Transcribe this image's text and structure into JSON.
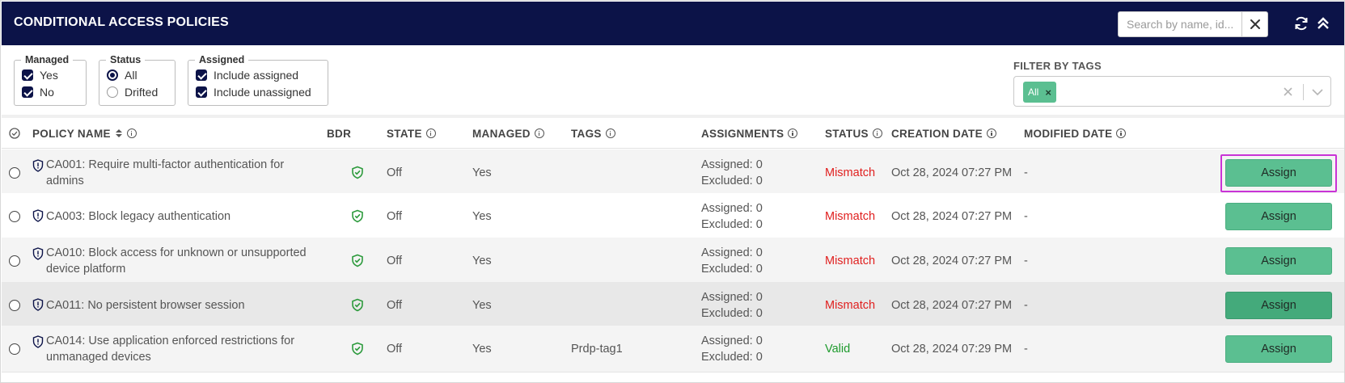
{
  "header": {
    "title": "CONDITIONAL ACCESS POLICIES",
    "search_placeholder": "Search by name, id...",
    "search_value": ""
  },
  "filters": {
    "managed": {
      "legend": "Managed",
      "options": [
        "Yes",
        "No"
      ],
      "checked": [
        true,
        true
      ]
    },
    "status": {
      "legend": "Status",
      "options": [
        "All",
        "Drifted"
      ],
      "selected": "All"
    },
    "assigned": {
      "legend": "Assigned",
      "options": [
        "Include assigned",
        "Include unassigned"
      ],
      "checked": [
        true,
        true
      ]
    },
    "tags": {
      "label": "FILTER BY TAGS",
      "chips": [
        "All"
      ]
    }
  },
  "columns": {
    "policy_name": "POLICY NAME",
    "bdr": "BDR",
    "state": "STATE",
    "managed": "MANAGED",
    "tags": "TAGS",
    "assignments": "ASSIGNMENTS",
    "status": "STATUS",
    "creation_date": "CREATION DATE",
    "modified_date": "MODIFIED DATE"
  },
  "rows": [
    {
      "name_line1": "CA001: Require multi-factor authentication for",
      "name_line2": "admins",
      "state": "Off",
      "managed": "Yes",
      "tags": "",
      "assigned": "Assigned: 0",
      "excluded": "Excluded: 0",
      "status": "Mismatch",
      "status_color": "#e0201f",
      "created": "Oct 28, 2024 07:27 PM",
      "modified": "-",
      "action": "Assign",
      "bg": "#f4f4f4",
      "highlighted": true
    },
    {
      "name_line1": "CA003: Block legacy authentication",
      "name_line2": "",
      "state": "Off",
      "managed": "Yes",
      "tags": "",
      "assigned": "Assigned: 0",
      "excluded": "Excluded: 0",
      "status": "Mismatch",
      "status_color": "#e0201f",
      "created": "Oct 28, 2024 07:27 PM",
      "modified": "-",
      "action": "Assign",
      "bg": "#ffffff",
      "highlighted": false
    },
    {
      "name_line1": "CA010: Block access for unknown or unsupported",
      "name_line2": "device platform",
      "state": "Off",
      "managed": "Yes",
      "tags": "",
      "assigned": "Assigned: 0",
      "excluded": "Excluded: 0",
      "status": "Mismatch",
      "status_color": "#e0201f",
      "created": "Oct 28, 2024 07:27 PM",
      "modified": "-",
      "action": "Assign",
      "bg": "#f4f4f4",
      "highlighted": false
    },
    {
      "name_line1": "CA011: No persistent browser session",
      "name_line2": "",
      "state": "Off",
      "managed": "Yes",
      "tags": "",
      "assigned": "Assigned: 0",
      "excluded": "Excluded: 0",
      "status": "Mismatch",
      "status_color": "#e0201f",
      "created": "Oct 28, 2024 07:27 PM",
      "modified": "-",
      "action": "Assign",
      "bg": "#e8e8e8",
      "highlighted": false
    },
    {
      "name_line1": "CA014: Use application enforced restrictions for",
      "name_line2": "unmanaged devices",
      "state": "Off",
      "managed": "Yes",
      "tags": "Prdp-tag1",
      "assigned": "Assigned: 0",
      "excluded": "Excluded: 0",
      "status": "Valid",
      "status_color": "#1d9a2c",
      "created": "Oct 28, 2024 07:29 PM",
      "modified": "-",
      "action": "Assign",
      "bg": "#f4f4f4",
      "highlighted": false
    }
  ],
  "colors": {
    "header_bg": "#0c1348",
    "button_green": "#5bbf91",
    "mismatch": "#e0201f",
    "valid": "#1d9a2c",
    "highlight": "#c933d6"
  }
}
